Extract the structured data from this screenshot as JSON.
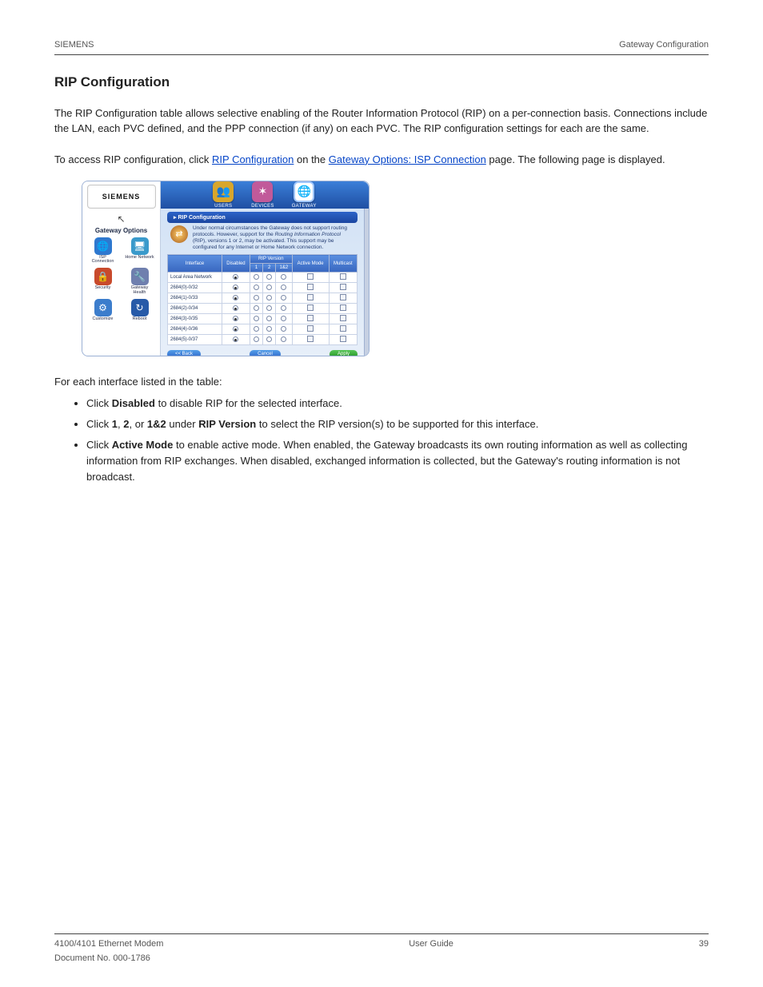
{
  "header": {
    "left": "SIEMENS",
    "right": "Gateway Configuration"
  },
  "section_title": "RIP Configuration",
  "intro_1": "The RIP Configuration table allows selective enabling of the Router Information Protocol (RIP) on a per-connection basis. Connections include the LAN, each PVC defined, and the PPP connection (if any) on each PVC. The RIP configuration settings for each are the same.",
  "intro_link_pre": "To access RIP configuration, click ",
  "intro_link": "RIP Configuration",
  "intro_2a": " on the ",
  "intro_2_bold": "Gateway Options: ISP Connection",
  "intro_2b": " page. The following page is displayed.",
  "screenshot": {
    "logo": "SIEMENS",
    "sidebar_title": "Gateway Options",
    "sidebar_icons": [
      [
        {
          "label": "ISP Connection",
          "glyph": "🌐",
          "bg": "#2e78cf"
        },
        {
          "label": "Home Network",
          "glyph": "🖥",
          "bg": "#3a9acb"
        }
      ],
      [
        {
          "label": "Security",
          "glyph": "🔒",
          "bg": "#c84a2c"
        },
        {
          "label": "Gateway Health",
          "glyph": "🔧",
          "bg": "#6f7fae"
        }
      ],
      [
        {
          "label": "Customize",
          "glyph": "⚙",
          "bg": "#3c7dcc"
        },
        {
          "label": "Reboot",
          "glyph": "↻",
          "bg": "#275aa8"
        }
      ]
    ],
    "topnav": [
      {
        "label": "USERS",
        "glyph": "👥",
        "bg": "#d8a62c"
      },
      {
        "label": "DEVICES",
        "glyph": "✶",
        "bg": "#c15a9a"
      },
      {
        "label": "GATEWAY",
        "glyph": "🌐",
        "bg": "#3a9a4a",
        "selected": true
      }
    ],
    "panel_title": "RIP Configuration",
    "panel_desc_1": "Under normal circumstances the Gateway does not support routing protocols. However, support for the ",
    "panel_desc_em": "Routing Information Protocol",
    "panel_desc_2": " (RIP), versions 1 or 2, may be activated. This support may be configured for any Internet or Home Network connection.",
    "columns": {
      "interface": "Interface",
      "disabled": "Disabled",
      "rip_version": "RIP Version",
      "v1": "1",
      "v2": "2",
      "v12": "1&2",
      "active": "Active Mode",
      "multicast": "Multicast"
    },
    "rows": [
      {
        "iface": "Local Area Network",
        "sel": "disabled"
      },
      {
        "iface": "2684(0)-0/32",
        "sel": "disabled"
      },
      {
        "iface": "2684(1)-0/33",
        "sel": "disabled"
      },
      {
        "iface": "2684(2)-0/34",
        "sel": "disabled"
      },
      {
        "iface": "2684(3)-0/35",
        "sel": "disabled"
      },
      {
        "iface": "2684(4)-0/36",
        "sel": "disabled"
      },
      {
        "iface": "2684(5)-0/37",
        "sel": "disabled"
      }
    ],
    "buttons": {
      "back": "<< Back",
      "cancel": "Cancel",
      "apply": "Apply"
    }
  },
  "instr_lead": "For each interface listed in the table:",
  "bullets": [
    {
      "pre": "Click ",
      "bold": "Disabled",
      "post": " to disable RIP for the selected interface."
    },
    {
      "pre": "Click ",
      "bold": "1",
      "mid": ", ",
      "bold2": "2",
      "mid2": ", or ",
      "bold3": "1&2",
      "post_pre": " under ",
      "bold4": "RIP Version",
      "post": " to select the RIP version(s) to be supported for this interface."
    },
    {
      "pre": "Click ",
      "bold": "Active Mode",
      "post": " to enable active mode. When enabled, the Gateway broadcasts its own routing information as well as collecting information from RIP exchanges. When disabled, exchanged information is collected, but the Gateway's routing information is not broadcast."
    }
  ],
  "footer": {
    "model": "4100/4101 Ethernet Modem",
    "guide": "User Guide",
    "page": "39",
    "doc": "Document No. 000-1786"
  }
}
